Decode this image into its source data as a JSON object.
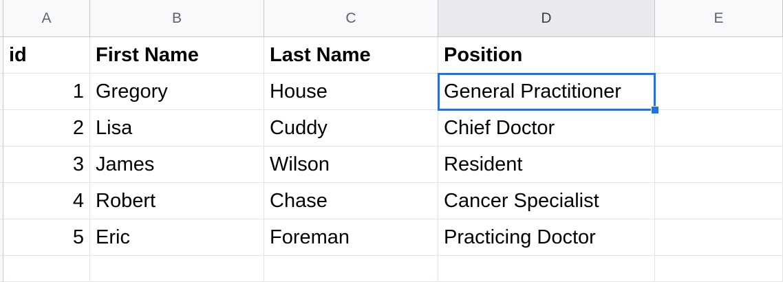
{
  "columns": [
    "A",
    "B",
    "C",
    "D",
    "E"
  ],
  "active_column": "D",
  "header_row": {
    "id": "id",
    "first_name": "First Name",
    "last_name": "Last Name",
    "position": "Position"
  },
  "rows": [
    {
      "id": "1",
      "first_name": "Gregory",
      "last_name": "House",
      "position": "General Practitioner"
    },
    {
      "id": "2",
      "first_name": "Lisa",
      "last_name": "Cuddy",
      "position": "Chief Doctor"
    },
    {
      "id": "3",
      "first_name": "James",
      "last_name": "Wilson",
      "position": "Resident"
    },
    {
      "id": "4",
      "first_name": "Robert",
      "last_name": "Chase",
      "position": "Cancer Specialist"
    },
    {
      "id": "5",
      "first_name": "Eric",
      "last_name": "Foreman",
      "position": "Practicing Doctor"
    }
  ],
  "selected_cell": "D2",
  "colors": {
    "selection": "#1a73e8",
    "header_bg": "#f8f9fa",
    "active_header_bg": "#e8eaed",
    "grid_line": "#e2e3e3"
  }
}
